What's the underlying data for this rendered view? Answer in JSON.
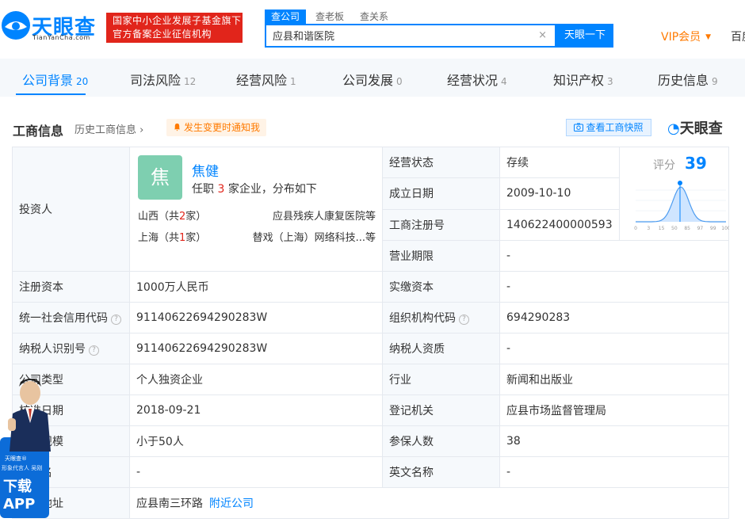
{
  "header": {
    "logo_text": "天眼查",
    "logo_sub": "TianYanCha.com",
    "gov_badge_line1": "国家中小企业发展子基金旗下",
    "gov_badge_line2": "官方备案企业征信机构",
    "search_tabs": [
      "查公司",
      "查老板",
      "查关系"
    ],
    "search_value": "应县和谐医院",
    "search_clear": "×",
    "search_button": "天眼一下",
    "vip_label": "VIP会员",
    "vip_arrow": "▼",
    "right_text": "百度"
  },
  "tabs": [
    {
      "label": "公司背景",
      "count": "20"
    },
    {
      "label": "司法风险",
      "count": "12"
    },
    {
      "label": "经营风险",
      "count": "1"
    },
    {
      "label": "公司发展",
      "count": "0"
    },
    {
      "label": "经营状况",
      "count": "4"
    },
    {
      "label": "知识产权",
      "count": "3"
    },
    {
      "label": "历史信息",
      "count": "9"
    }
  ],
  "section": {
    "title": "工商信息",
    "history_link": "历史工商信息",
    "history_arrow": "›",
    "notify_button": "发生变更时通知我",
    "snapshot_button": "查看工商快照",
    "brand": "天眼查"
  },
  "investor": {
    "label": "投资人",
    "avatar_char": "焦",
    "name": "焦健",
    "role_prefix": "任职",
    "role_count": "3",
    "role_suffix": "家企业，分布如下",
    "regions": [
      {
        "prefix": "山西（共",
        "count": "2",
        "suffix": "家）",
        "company": "应县残疾人康复医院等"
      },
      {
        "prefix": "上海（共",
        "count": "1",
        "suffix": "家）",
        "company": "替戏（上海）网络科技...等"
      }
    ]
  },
  "right_top": [
    {
      "label": "经营状态",
      "value": "存续"
    },
    {
      "label": "成立日期",
      "value": "2009-10-10"
    },
    {
      "label": "工商注册号",
      "value": "140622400000593"
    },
    {
      "label": "营业期限",
      "value": "-"
    }
  ],
  "score": {
    "title": "评分",
    "value": 39,
    "axis_ticks": [
      "0",
      "3",
      "15",
      "50",
      "85",
      "97",
      "99",
      "100"
    ]
  },
  "rows": [
    {
      "l1": "注册资本",
      "v1": "1000万人民币",
      "l2": "实缴资本",
      "v2": "-",
      "q1": false,
      "q2": false
    },
    {
      "l1": "统一社会信用代码",
      "v1": "91140622694290283W",
      "l2": "组织机构代码",
      "v2": "694290283",
      "q1": true,
      "q2": true
    },
    {
      "l1": "纳税人识别号",
      "v1": "91140622694290283W",
      "l2": "纳税人资质",
      "v2": "-",
      "q1": true,
      "q2": false
    },
    {
      "l1": "公司类型",
      "v1": "个人独资企业",
      "l2": "行业",
      "v2": "新闻和出版业",
      "q1": false,
      "q2": false
    },
    {
      "l1": "核准日期",
      "v1": "2018-09-21",
      "l2": "登记机关",
      "v2": "应县市场监督管理局",
      "q1": false,
      "q2": false
    },
    {
      "l1": "人员规模",
      "v1": "小于50人",
      "l2": "参保人数",
      "v2": "38",
      "q1": false,
      "q2": false
    },
    {
      "l1": "曾用名",
      "v1": "-",
      "l2": "英文名称",
      "v2": "-",
      "q1": false,
      "q2": false
    },
    {
      "l1": "注册地址",
      "v1": "应县南三环路",
      "v1_link": "附近公司",
      "wide": true
    }
  ],
  "promo": {
    "brand": "天眼查®",
    "desc": "形象代言人 吴刚",
    "download": "下载",
    "app": "APP"
  },
  "colors": {
    "accent": "#0084ff",
    "badge_red": "#e1251b",
    "vip_orange": "#ff7a00",
    "label_bg": "#f6f9fc"
  }
}
